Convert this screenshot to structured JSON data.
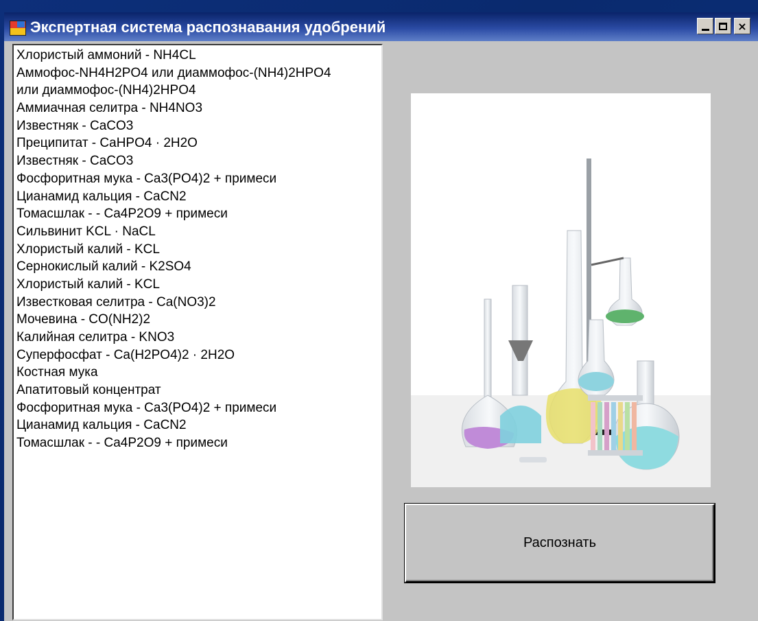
{
  "window": {
    "title": "Экспертная система распознавания удобрений",
    "controls": {
      "minimize": "minimize-icon",
      "maximize": "maximize-icon",
      "close": "×"
    }
  },
  "list": {
    "items": [
      "Хлористый аммоний - NH4CL",
      "Аммофос-NH4H2PO4 или диаммофос-(NH4)2HPO4",
      "или диаммофос-(NH4)2HPO4",
      "Аммиачная селитра - NH4NO3",
      "Известняк - CaCO3",
      "Преципитат - CaHPO4 · 2H2O",
      "Известняк - CaCO3",
      "Фосфоритная мука - Ca3(PO4)2 + примеси",
      "Цианамид кальция - CaCN2",
      "Томасшлак - - Ca4P2O9 + примеси",
      "Сильвинит  KCL · NaCL",
      "Хлористый калий - KCL",
      "Сернокислый калий - K2SO4",
      "Хлористый калий - KCL",
      "Известковая селитра - Ca(NO3)2",
      "Мочевина - CO(NH2)2",
      "Калийная селитра - KNO3",
      "Суперфосфат - Ca(H2PO4)2 · 2H2O",
      "Костная мука",
      "Апатитовый концентрат",
      "Фосфоритная мука - Ca3(PO4)2 + примеси",
      "Цианамид кальция - CaCN2",
      "Томасшлак - - Ca4P2O9 + примеси"
    ]
  },
  "recognize_button": {
    "label": "Распознать"
  },
  "colors": {
    "titlebar": "#0a246a",
    "window": "#c4c4c4",
    "desktop": "#0d2f7a"
  }
}
